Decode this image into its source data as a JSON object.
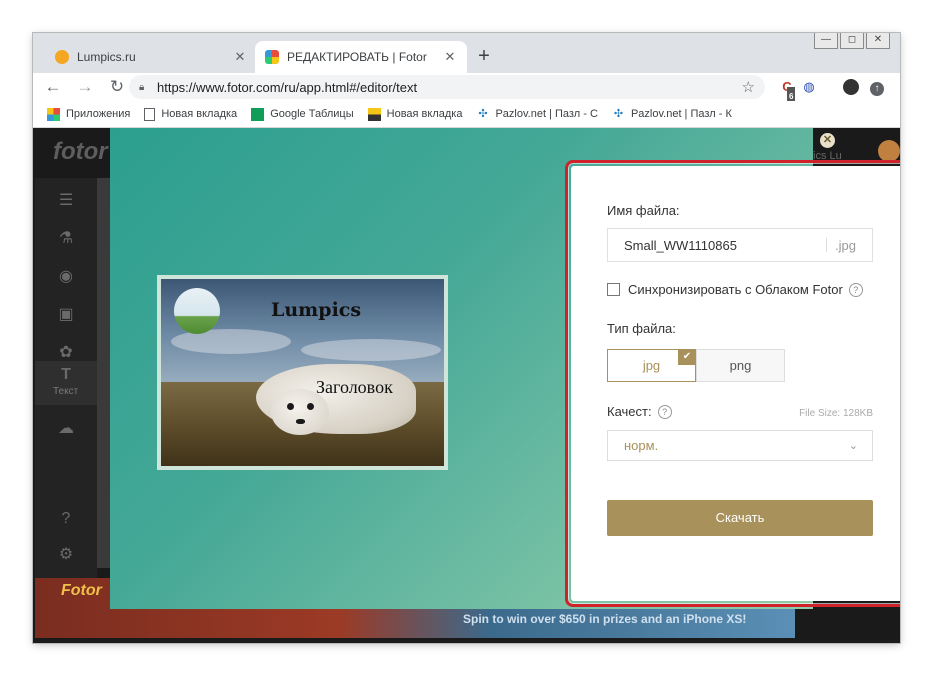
{
  "browser": {
    "tabs": [
      {
        "title": "Lumpics.ru",
        "favicon_color": "#f5a623"
      },
      {
        "title": "РЕДАКТИРОВАТЬ | Fotor",
        "favicon_color": "#e84c3d"
      }
    ],
    "window_controls": [
      "—",
      "◻",
      "✕"
    ],
    "url": "https://www.fotor.com/ru/app.html#/editor/text",
    "extension_badge": "6",
    "bookmarks": [
      {
        "label": "Приложения",
        "icon": "apps-grid-icon"
      },
      {
        "label": "Новая вкладка",
        "icon": "page-icon"
      },
      {
        "label": "Google Таблицы",
        "icon": "sheets-icon"
      },
      {
        "label": "Новая вкладка",
        "icon": "image-icon"
      },
      {
        "label": "Pazlov.net | Пазл - С",
        "icon": "puzzle-icon"
      },
      {
        "label": "Pazlov.net | Пазл - К",
        "icon": "puzzle-icon"
      }
    ]
  },
  "app": {
    "logo": "fotor",
    "rail_label": "Текст",
    "user_name": "ics Lu",
    "banner_logo": "Fotor",
    "banner_text": "Spin to win over $650 in prizes and an iPhone XS!"
  },
  "preview": {
    "title": "Lumpics",
    "subtitle": "Заголовок"
  },
  "export": {
    "filename_label": "Имя файла:",
    "filename_value": "Small_WW1110865",
    "filename_ext": ".jpg",
    "sync_label": "Синхронизировать с Облаком Fotor",
    "sync_checked": false,
    "filetype_label": "Тип файла:",
    "filetype_options": [
      "jpg",
      "png"
    ],
    "filetype_selected": "jpg",
    "quality_label": "Качест:",
    "file_size": "File Size: 128KB",
    "quality_value": "норм.",
    "download_label": "Скачать",
    "accent_color": "#a8915a",
    "highlight_color": "#d0222a"
  }
}
